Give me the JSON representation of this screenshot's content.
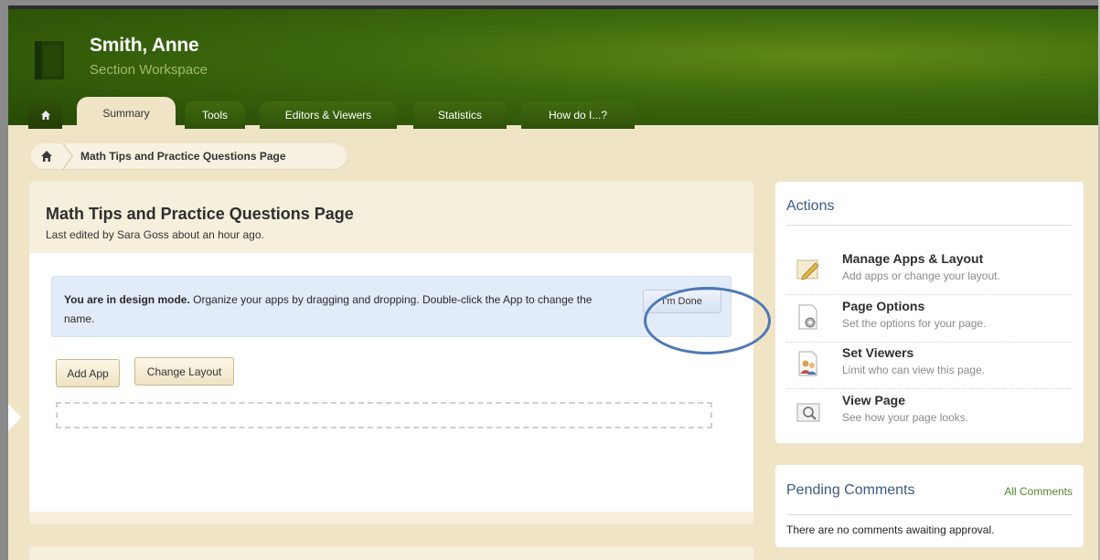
{
  "header": {
    "user_name": "Smith, Anne",
    "workspace_label": "Section Workspace"
  },
  "tabs": [
    {
      "label": "Summary",
      "active": true
    },
    {
      "label": "Tools",
      "active": false
    },
    {
      "label": "Editors & Viewers",
      "active": false
    },
    {
      "label": "Statistics",
      "active": false
    },
    {
      "label": "How do I...?",
      "active": false
    }
  ],
  "breadcrumb": {
    "home_icon": "home-icon",
    "current": "Math Tips and Practice Questions Page"
  },
  "main": {
    "title": "Math Tips and Practice Questions Page",
    "last_edited": "Last edited by Sara Goss about an hour ago.",
    "design_mode": {
      "bold": "You are in design mode.",
      "text": " Organize your apps by dragging and dropping. Double-click the App to change the name.",
      "done_button": "I'm Done"
    },
    "add_app_button": "Add App",
    "change_layout_button": "Change Layout"
  },
  "actions": {
    "title": "Actions",
    "items": [
      {
        "label": "Manage Apps & Layout",
        "desc": "Add apps or change your layout.",
        "icon": "pencil-icon"
      },
      {
        "label": "Page Options",
        "desc": "Set the options for your page.",
        "icon": "gear-page-icon"
      },
      {
        "label": "Set Viewers",
        "desc": "Limit who can view this page.",
        "icon": "people-icon"
      },
      {
        "label": "View Page",
        "desc": "See how your page looks.",
        "icon": "magnifier-page-icon"
      }
    ]
  },
  "comments": {
    "title": "Pending Comments",
    "all_link": "All Comments",
    "empty_text": "There are no comments awaiting approval."
  },
  "colors": {
    "header_green": "#3d6a0d",
    "page_beige": "#efe4c6",
    "design_blue": "#e2ebf8",
    "link_green": "#4f8a2a",
    "heading_blue": "#3a5a86"
  }
}
